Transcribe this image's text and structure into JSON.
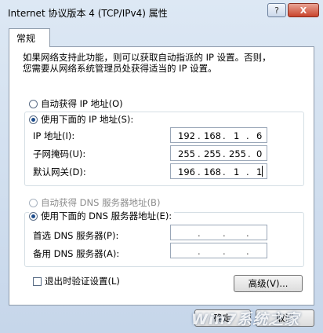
{
  "window": {
    "title": "Internet 协议版本 4 (TCP/IPv4) 属性",
    "help_label": "?",
    "close_label": "X"
  },
  "tabs": [
    {
      "label": "常规"
    }
  ],
  "description": {
    "line1": "如果网络支持此功能，则可以获取自动指派的 IP 设置。否则，",
    "line2": "您需要从网络系统管理员处获得适当的 IP 设置。"
  },
  "ip_section": {
    "auto_label": "自动获得 IP 地址(O)",
    "manual_label": "使用下面的 IP 地址(S):",
    "selected": "manual",
    "fields": [
      {
        "label": "IP 地址(I):",
        "octets": [
          "192",
          "168",
          "1",
          "6"
        ]
      },
      {
        "label": "子网掩码(U):",
        "octets": [
          "255",
          "255",
          "255",
          "0"
        ]
      },
      {
        "label": "默认网关(D):",
        "octets": [
          "196",
          "168",
          "1",
          "1"
        ]
      }
    ]
  },
  "dns_section": {
    "auto_label": "自动获得 DNS 服务器地址(B)",
    "manual_label": "使用下面的 DNS 服务器地址(E):",
    "selected": "manual",
    "fields": [
      {
        "label": "首选 DNS 服务器(P):",
        "octets": [
          "",
          "",
          "",
          ""
        ]
      },
      {
        "label": "备用 DNS 服务器(A):",
        "octets": [
          "",
          "",
          "",
          ""
        ]
      }
    ]
  },
  "validate_on_exit": {
    "label": "退出时验证设置(L)",
    "checked": false
  },
  "buttons": {
    "advanced": "高级(V)...",
    "ok": "确定",
    "cancel": "取消"
  },
  "watermark": "Win7系统之家",
  "colors": {
    "accent": "#1e4d8c",
    "close": "#c9442c"
  }
}
